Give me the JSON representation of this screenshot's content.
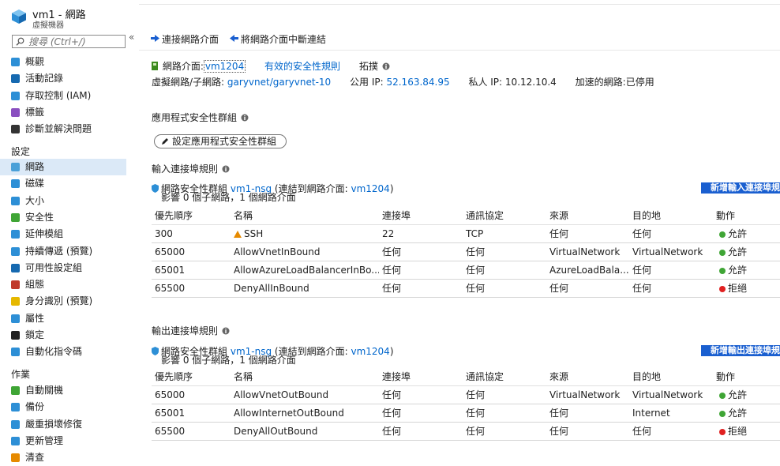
{
  "header": {
    "title": "vm1 - 網路",
    "subtitle": "虛擬機器"
  },
  "search": {
    "placeholder": "搜尋 (Ctrl+/)"
  },
  "sidebar": {
    "collapse_glyph": "«",
    "items_top": [
      {
        "label": "概觀",
        "icon": "overview-icon"
      },
      {
        "label": "活動記錄",
        "icon": "activity-log-icon"
      },
      {
        "label": "存取控制 (IAM)",
        "icon": "iam-icon"
      },
      {
        "label": "標籤",
        "icon": "tag-icon"
      },
      {
        "label": "診斷並解決問題",
        "icon": "wrench-icon"
      }
    ],
    "section_settings": "設定",
    "items_settings": [
      {
        "label": "網路",
        "icon": "network-icon"
      },
      {
        "label": "磁碟",
        "icon": "disk-icon"
      },
      {
        "label": "大小",
        "icon": "size-icon"
      },
      {
        "label": "安全性",
        "icon": "shield-icon"
      },
      {
        "label": "延伸模組",
        "icon": "extensions-icon"
      },
      {
        "label": "持續傳遞 (預覽)",
        "icon": "delivery-icon"
      },
      {
        "label": "可用性設定組",
        "icon": "availability-icon"
      },
      {
        "label": "組態",
        "icon": "config-icon"
      },
      {
        "label": "身分識別 (預覽)",
        "icon": "identity-icon"
      },
      {
        "label": "屬性",
        "icon": "properties-icon"
      },
      {
        "label": "鎖定",
        "icon": "lock-icon"
      },
      {
        "label": "自動化指令碼",
        "icon": "script-icon"
      }
    ],
    "section_operations": "作業",
    "items_operations": [
      {
        "label": "自動關機",
        "icon": "clock-icon"
      },
      {
        "label": "備份",
        "icon": "backup-icon"
      },
      {
        "label": "嚴重損壞修復",
        "icon": "recovery-icon"
      },
      {
        "label": "更新管理",
        "icon": "update-icon"
      },
      {
        "label": "清查",
        "icon": "inventory-icon"
      }
    ]
  },
  "toolbar": {
    "attach": "連接網路介面",
    "detach": "將網路介面中斷連結"
  },
  "nic": {
    "label": "網路介面:",
    "name": "vm1204",
    "effective_rules": "有效的安全性規則",
    "topology": "拓撲",
    "vnet_label": "虛擬網路/子網路:",
    "vnet_value": "garyvnet/garyvnet-10",
    "public_ip_label": "公用 IP:",
    "public_ip": "52.163.84.95",
    "private_ip_label": "私人 IP:",
    "private_ip": "10.12.10.4",
    "accel_label": "加速的網路:",
    "accel_value": "已停用"
  },
  "asg": {
    "title": "應用程式安全性群組",
    "button": "設定應用程式安全性群組"
  },
  "inbound": {
    "title": "輸入連接埠規則",
    "nsg_prefix": "網路安全性群組",
    "nsg_name": "vm1-nsg",
    "nsg_attached": "(連結到網路介面:",
    "nsg_nic": "vm1204",
    "nsg_close": ")",
    "impact": "影響 0 個子網路，1 個網路介面",
    "add_button": "新增輸入連接埠規則",
    "columns": [
      "優先順序",
      "名稱",
      "連接埠",
      "通訊協定",
      "來源",
      "目的地",
      "動作"
    ],
    "rows": [
      {
        "priority": "300",
        "name": "SSH",
        "warn": true,
        "port": "22",
        "protocol": "TCP",
        "source": "任何",
        "destination": "任何",
        "action": "允許",
        "allow": true
      },
      {
        "priority": "65000",
        "name": "AllowVnetInBound",
        "warn": false,
        "port": "任何",
        "protocol": "任何",
        "source": "VirtualNetwork",
        "destination": "VirtualNetwork",
        "action": "允許",
        "allow": true
      },
      {
        "priority": "65001",
        "name": "AllowAzureLoadBalancerInBo...",
        "warn": false,
        "port": "任何",
        "protocol": "任何",
        "source": "AzureLoadBala...",
        "destination": "任何",
        "action": "允許",
        "allow": true
      },
      {
        "priority": "65500",
        "name": "DenyAllInBound",
        "warn": false,
        "port": "任何",
        "protocol": "任何",
        "source": "任何",
        "destination": "任何",
        "action": "拒絕",
        "allow": false
      }
    ]
  },
  "outbound": {
    "title": "輸出連接埠規則",
    "nsg_prefix": "網路安全性群組",
    "nsg_name": "vm1-nsg",
    "nsg_attached": "(連結到網路介面:",
    "nsg_nic": "vm1204",
    "nsg_close": ")",
    "impact": "影響 0 個子網路，1 個網路介面",
    "add_button": "新增輸出連接埠規則",
    "columns": [
      "優先順序",
      "名稱",
      "連接埠",
      "通訊協定",
      "來源",
      "目的地",
      "動作"
    ],
    "rows": [
      {
        "priority": "65000",
        "name": "AllowVnetOutBound",
        "warn": false,
        "port": "任何",
        "protocol": "任何",
        "source": "VirtualNetwork",
        "destination": "VirtualNetwork",
        "action": "允許",
        "allow": true
      },
      {
        "priority": "65001",
        "name": "AllowInternetOutBound",
        "warn": false,
        "port": "任何",
        "protocol": "任何",
        "source": "任何",
        "destination": "Internet",
        "action": "允許",
        "allow": true
      },
      {
        "priority": "65500",
        "name": "DenyAllOutBound",
        "warn": false,
        "port": "任何",
        "protocol": "任何",
        "source": "任何",
        "destination": "任何",
        "action": "拒絕",
        "allow": false
      }
    ]
  },
  "colors": {
    "accent": "#0066cc",
    "add_button": "#1a5fd0",
    "active_nav": "#dbe9f7",
    "allow": "#3fa535",
    "deny": "#e02020",
    "warning": "#e68a00"
  }
}
